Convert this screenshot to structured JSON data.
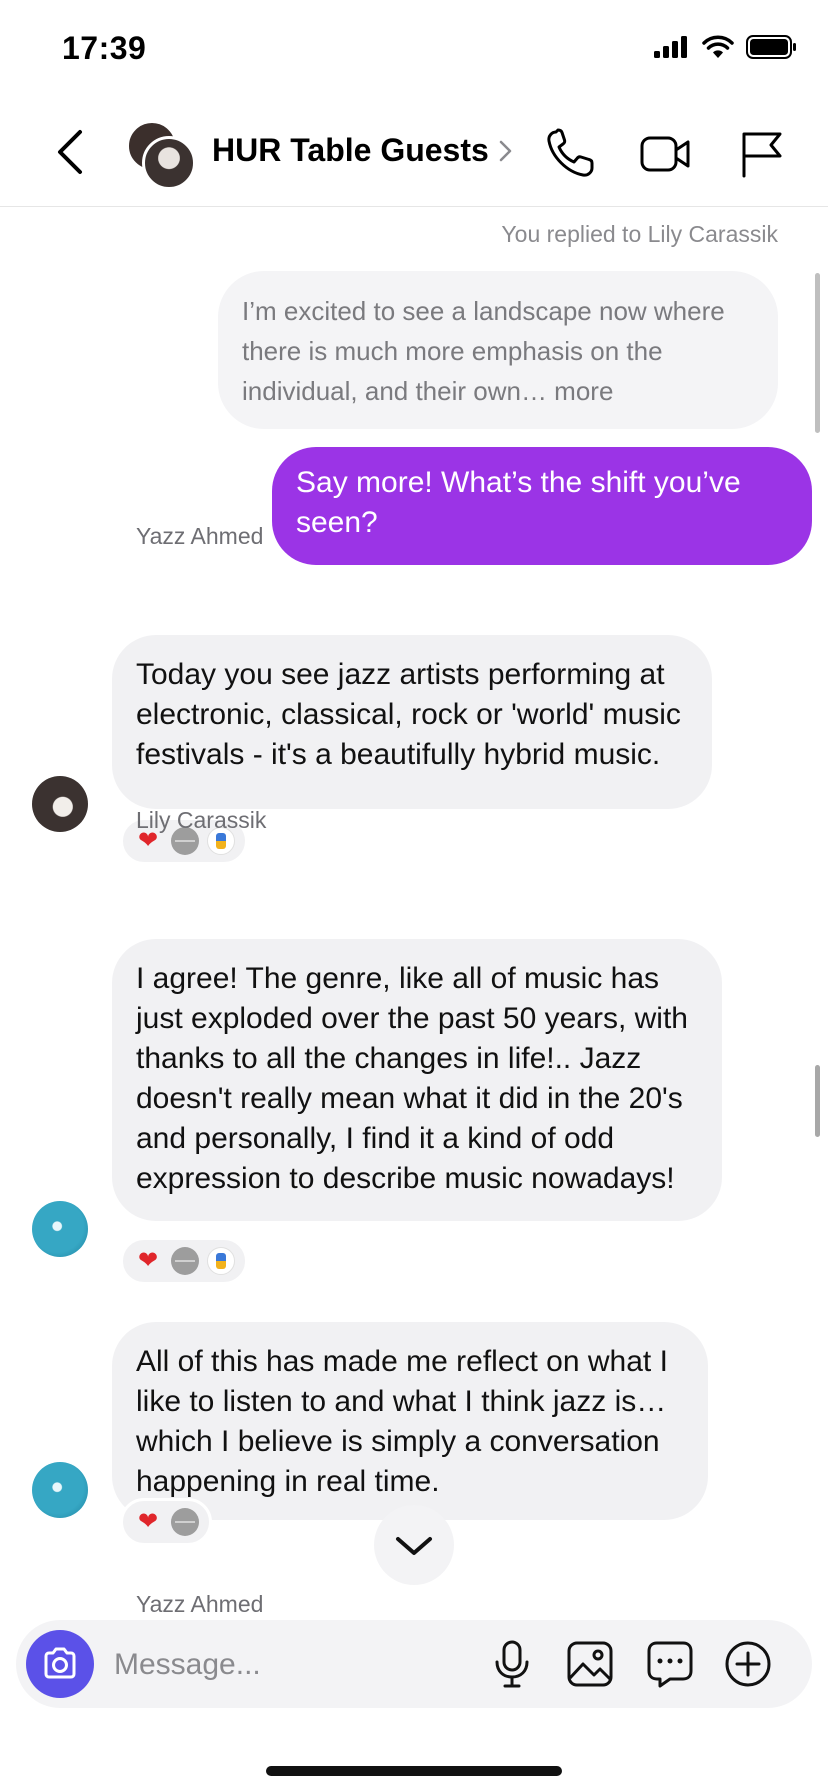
{
  "status_bar": {
    "time": "17:39"
  },
  "header": {
    "title": "HUR Table Guests"
  },
  "conversation": {
    "reply_caption": "You replied to Lily Carassik",
    "quoted_message": "I’m excited to see a landscape now where there is much more emphasis on the individual, and their own… more",
    "outgoing_message": "Say more! What’s the shift you’ve seen?",
    "messages": [
      {
        "sender": "Yazz Ahmed",
        "text": "Today you see jazz artists performing at electronic, classical, rock or 'world' music festivals - it's a beautifully hybrid music.",
        "reactions": [
          "red-heart",
          "grey-emoji",
          "badge-emoji"
        ]
      },
      {
        "sender": "Lily Carassik",
        "text": "I agree! The genre, like all of music has just exploded over the past 50 years, with thanks to all the changes in life!.. Jazz doesn't really mean what it did in the 20's and personally, I find it a kind of odd expression to describe music nowadays!",
        "reactions": [
          "red-heart",
          "grey-emoji",
          "badge-emoji"
        ]
      },
      {
        "sender": "",
        "text": "All of this has made me reflect on what I like to listen to and what I think jazz is… which I believe is simply a conversation happening in real time.",
        "reactions": [
          "red-heart",
          "grey-emoji"
        ]
      }
    ],
    "next_sender": "Yazz Ahmed",
    "reaction_glyphs": {
      "heart": "❤"
    }
  },
  "composer": {
    "placeholder": "Message..."
  },
  "colors": {
    "outgoing_bubble": "#9b34e6",
    "incoming_bubble": "#f1f1f3",
    "camera_button": "#5b51e8"
  }
}
